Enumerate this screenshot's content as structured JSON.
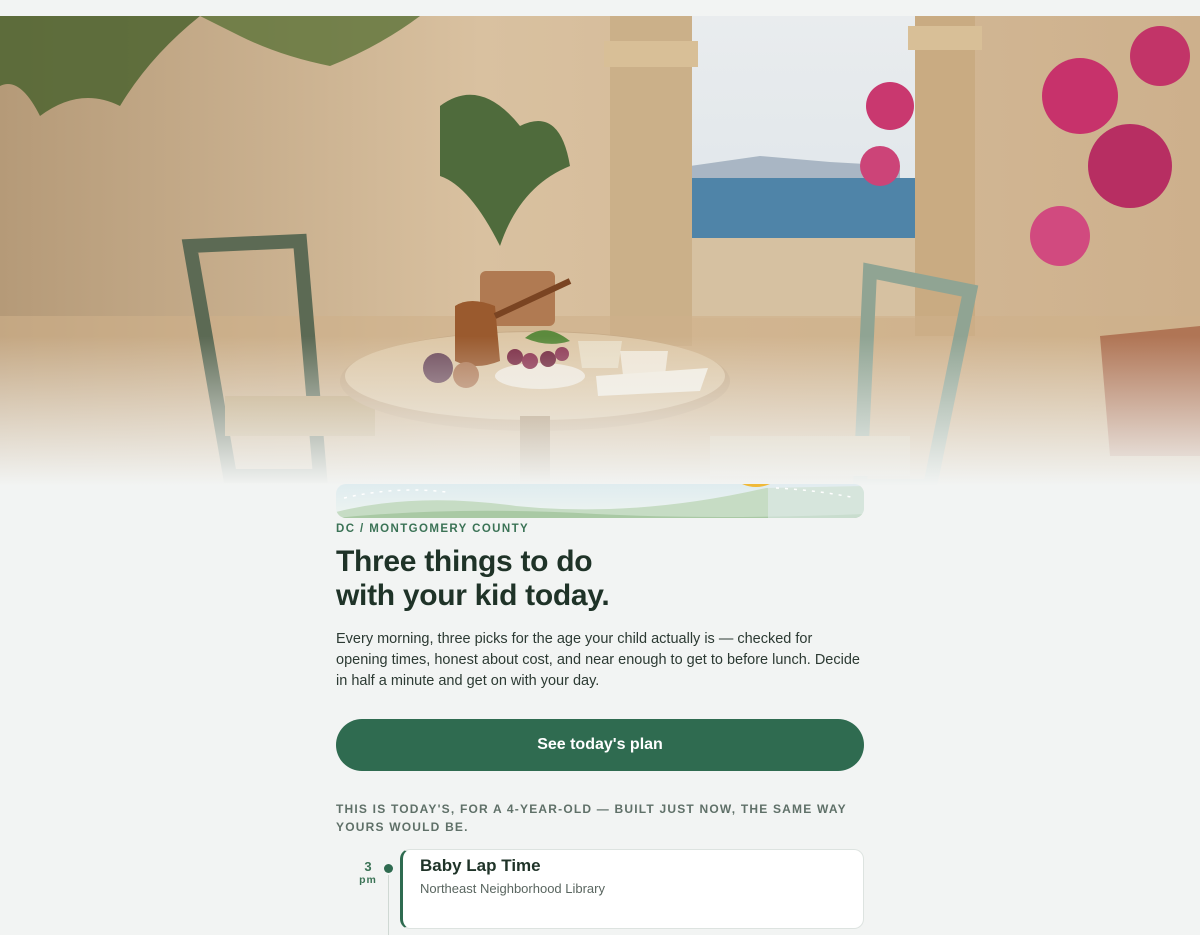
{
  "hero": {
    "image_description_icon": "terrace-table-photo"
  },
  "eyebrow": "DC / MONTGOMERY COUNTY",
  "headline": {
    "line1": "Three things to do",
    "line2": "with your kid today."
  },
  "lead": "Every morning, three picks for the age your child actually is — checked for opening times, honest about cost, and near enough to get to before lunch. Decide in half a minute and get on with your day.",
  "cta_label": "See today's plan",
  "note": "THIS IS TODAY'S, FOR A 4-YEAR-OLD — BUILT JUST NOW, THE SAME WAY YOURS WOULD BE.",
  "plan": {
    "items": [
      {
        "time": "3",
        "ampm": "pm",
        "title": "Baby Lap Time",
        "place": "Northeast Neighborhood Library"
      }
    ]
  },
  "colors": {
    "accent": "#2f6b50",
    "eyebrow": "#3b7356",
    "heading": "#1f3328",
    "background": "#f2f4f3"
  }
}
